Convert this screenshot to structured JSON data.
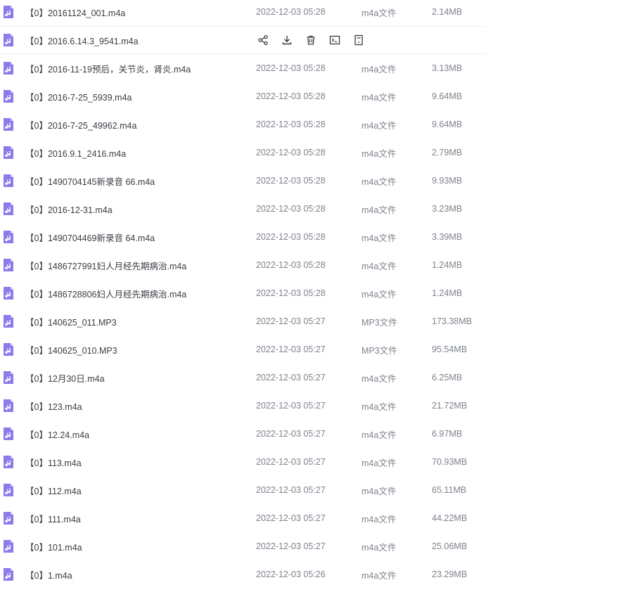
{
  "file_list": {
    "rows": [
      {
        "name": "【0】20161124_001.m4a",
        "date": "2022-12-03 05:28",
        "type": "m4a文件",
        "size": "2.14MB"
      },
      {
        "name": "【0】2016.6.14.3_9541.m4a",
        "date": "",
        "type": "",
        "size": "",
        "hovered": true
      },
      {
        "name": "【0】2016-11-19预后，关节炎，肾炎.m4a",
        "date": "2022-12-03 05:28",
        "type": "m4a文件",
        "size": "3.13MB"
      },
      {
        "name": "【0】2016-7-25_5939.m4a",
        "date": "2022-12-03 05:28",
        "type": "m4a文件",
        "size": "9.64MB"
      },
      {
        "name": "【0】2016-7-25_49962.m4a",
        "date": "2022-12-03 05:28",
        "type": "m4a文件",
        "size": "9.64MB"
      },
      {
        "name": "【0】2016.9.1_2416.m4a",
        "date": "2022-12-03 05:28",
        "type": "m4a文件",
        "size": "2.79MB"
      },
      {
        "name": "【0】1490704145新录音 66.m4a",
        "date": "2022-12-03 05:28",
        "type": "m4a文件",
        "size": "9.93MB"
      },
      {
        "name": "【0】2016-12-31.m4a",
        "date": "2022-12-03 05:28",
        "type": "m4a文件",
        "size": "3.23MB"
      },
      {
        "name": "【0】1490704469新录音 64.m4a",
        "date": "2022-12-03 05:28",
        "type": "m4a文件",
        "size": "3.39MB"
      },
      {
        "name": "【0】1486727991妇人月经先期病治.m4a",
        "date": "2022-12-03 05:28",
        "type": "m4a文件",
        "size": "1.24MB"
      },
      {
        "name": "【0】1486728806妇人月经先期病治.m4a",
        "date": "2022-12-03 05:28",
        "type": "m4a文件",
        "size": "1.24MB"
      },
      {
        "name": "【0】140625_011.MP3",
        "date": "2022-12-03 05:27",
        "type": "MP3文件",
        "size": "173.38MB"
      },
      {
        "name": "【0】140625_010.MP3",
        "date": "2022-12-03 05:27",
        "type": "MP3文件",
        "size": "95.54MB"
      },
      {
        "name": "【0】12月30日.m4a",
        "date": "2022-12-03 05:27",
        "type": "m4a文件",
        "size": "6.25MB"
      },
      {
        "name": "【0】123.m4a",
        "date": "2022-12-03 05:27",
        "type": "m4a文件",
        "size": "21.72MB"
      },
      {
        "name": "【0】12.24.m4a",
        "date": "2022-12-03 05:27",
        "type": "m4a文件",
        "size": "6.97MB"
      },
      {
        "name": "【0】113.m4a",
        "date": "2022-12-03 05:27",
        "type": "m4a文件",
        "size": "70.93MB"
      },
      {
        "name": "【0】112.m4a",
        "date": "2022-12-03 05:27",
        "type": "m4a文件",
        "size": "65.11MB"
      },
      {
        "name": "【0】111.m4a",
        "date": "2022-12-03 05:27",
        "type": "m4a文件",
        "size": "44.22MB"
      },
      {
        "name": "【0】101.m4a",
        "date": "2022-12-03 05:27",
        "type": "m4a文件",
        "size": "25.06MB"
      },
      {
        "name": "【0】1.m4a",
        "date": "2022-12-03 05:26",
        "type": "m4a文件",
        "size": "23.29MB"
      }
    ],
    "row_actions": [
      "share-icon",
      "download-icon",
      "delete-icon",
      "terminal-icon",
      "more-icon"
    ],
    "icon_color": "#8c7bea"
  }
}
